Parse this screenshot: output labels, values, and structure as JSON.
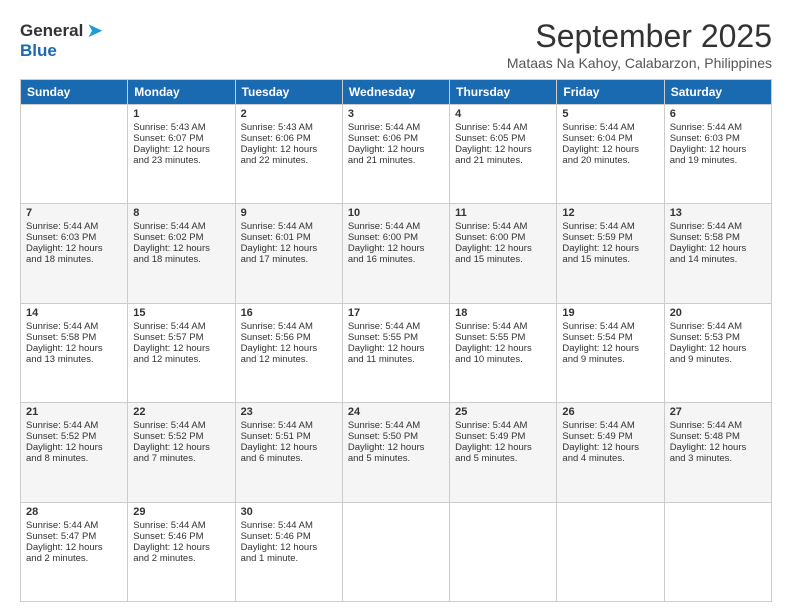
{
  "header": {
    "logo_general": "General",
    "logo_blue": "Blue",
    "title": "September 2025",
    "subtitle": "Mataas Na Kahoy, Calabarzon, Philippines"
  },
  "days_of_week": [
    "Sunday",
    "Monday",
    "Tuesday",
    "Wednesday",
    "Thursday",
    "Friday",
    "Saturday"
  ],
  "weeks": [
    [
      {
        "num": "",
        "lines": []
      },
      {
        "num": "1",
        "lines": [
          "Sunrise: 5:43 AM",
          "Sunset: 6:07 PM",
          "Daylight: 12 hours",
          "and 23 minutes."
        ]
      },
      {
        "num": "2",
        "lines": [
          "Sunrise: 5:43 AM",
          "Sunset: 6:06 PM",
          "Daylight: 12 hours",
          "and 22 minutes."
        ]
      },
      {
        "num": "3",
        "lines": [
          "Sunrise: 5:44 AM",
          "Sunset: 6:06 PM",
          "Daylight: 12 hours",
          "and 21 minutes."
        ]
      },
      {
        "num": "4",
        "lines": [
          "Sunrise: 5:44 AM",
          "Sunset: 6:05 PM",
          "Daylight: 12 hours",
          "and 21 minutes."
        ]
      },
      {
        "num": "5",
        "lines": [
          "Sunrise: 5:44 AM",
          "Sunset: 6:04 PM",
          "Daylight: 12 hours",
          "and 20 minutes."
        ]
      },
      {
        "num": "6",
        "lines": [
          "Sunrise: 5:44 AM",
          "Sunset: 6:03 PM",
          "Daylight: 12 hours",
          "and 19 minutes."
        ]
      }
    ],
    [
      {
        "num": "7",
        "lines": [
          "Sunrise: 5:44 AM",
          "Sunset: 6:03 PM",
          "Daylight: 12 hours",
          "and 18 minutes."
        ]
      },
      {
        "num": "8",
        "lines": [
          "Sunrise: 5:44 AM",
          "Sunset: 6:02 PM",
          "Daylight: 12 hours",
          "and 18 minutes."
        ]
      },
      {
        "num": "9",
        "lines": [
          "Sunrise: 5:44 AM",
          "Sunset: 6:01 PM",
          "Daylight: 12 hours",
          "and 17 minutes."
        ]
      },
      {
        "num": "10",
        "lines": [
          "Sunrise: 5:44 AM",
          "Sunset: 6:00 PM",
          "Daylight: 12 hours",
          "and 16 minutes."
        ]
      },
      {
        "num": "11",
        "lines": [
          "Sunrise: 5:44 AM",
          "Sunset: 6:00 PM",
          "Daylight: 12 hours",
          "and 15 minutes."
        ]
      },
      {
        "num": "12",
        "lines": [
          "Sunrise: 5:44 AM",
          "Sunset: 5:59 PM",
          "Daylight: 12 hours",
          "and 15 minutes."
        ]
      },
      {
        "num": "13",
        "lines": [
          "Sunrise: 5:44 AM",
          "Sunset: 5:58 PM",
          "Daylight: 12 hours",
          "and 14 minutes."
        ]
      }
    ],
    [
      {
        "num": "14",
        "lines": [
          "Sunrise: 5:44 AM",
          "Sunset: 5:58 PM",
          "Daylight: 12 hours",
          "and 13 minutes."
        ]
      },
      {
        "num": "15",
        "lines": [
          "Sunrise: 5:44 AM",
          "Sunset: 5:57 PM",
          "Daylight: 12 hours",
          "and 12 minutes."
        ]
      },
      {
        "num": "16",
        "lines": [
          "Sunrise: 5:44 AM",
          "Sunset: 5:56 PM",
          "Daylight: 12 hours",
          "and 12 minutes."
        ]
      },
      {
        "num": "17",
        "lines": [
          "Sunrise: 5:44 AM",
          "Sunset: 5:55 PM",
          "Daylight: 12 hours",
          "and 11 minutes."
        ]
      },
      {
        "num": "18",
        "lines": [
          "Sunrise: 5:44 AM",
          "Sunset: 5:55 PM",
          "Daylight: 12 hours",
          "and 10 minutes."
        ]
      },
      {
        "num": "19",
        "lines": [
          "Sunrise: 5:44 AM",
          "Sunset: 5:54 PM",
          "Daylight: 12 hours",
          "and 9 minutes."
        ]
      },
      {
        "num": "20",
        "lines": [
          "Sunrise: 5:44 AM",
          "Sunset: 5:53 PM",
          "Daylight: 12 hours",
          "and 9 minutes."
        ]
      }
    ],
    [
      {
        "num": "21",
        "lines": [
          "Sunrise: 5:44 AM",
          "Sunset: 5:52 PM",
          "Daylight: 12 hours",
          "and 8 minutes."
        ]
      },
      {
        "num": "22",
        "lines": [
          "Sunrise: 5:44 AM",
          "Sunset: 5:52 PM",
          "Daylight: 12 hours",
          "and 7 minutes."
        ]
      },
      {
        "num": "23",
        "lines": [
          "Sunrise: 5:44 AM",
          "Sunset: 5:51 PM",
          "Daylight: 12 hours",
          "and 6 minutes."
        ]
      },
      {
        "num": "24",
        "lines": [
          "Sunrise: 5:44 AM",
          "Sunset: 5:50 PM",
          "Daylight: 12 hours",
          "and 5 minutes."
        ]
      },
      {
        "num": "25",
        "lines": [
          "Sunrise: 5:44 AM",
          "Sunset: 5:49 PM",
          "Daylight: 12 hours",
          "and 5 minutes."
        ]
      },
      {
        "num": "26",
        "lines": [
          "Sunrise: 5:44 AM",
          "Sunset: 5:49 PM",
          "Daylight: 12 hours",
          "and 4 minutes."
        ]
      },
      {
        "num": "27",
        "lines": [
          "Sunrise: 5:44 AM",
          "Sunset: 5:48 PM",
          "Daylight: 12 hours",
          "and 3 minutes."
        ]
      }
    ],
    [
      {
        "num": "28",
        "lines": [
          "Sunrise: 5:44 AM",
          "Sunset: 5:47 PM",
          "Daylight: 12 hours",
          "and 2 minutes."
        ]
      },
      {
        "num": "29",
        "lines": [
          "Sunrise: 5:44 AM",
          "Sunset: 5:46 PM",
          "Daylight: 12 hours",
          "and 2 minutes."
        ]
      },
      {
        "num": "30",
        "lines": [
          "Sunrise: 5:44 AM",
          "Sunset: 5:46 PM",
          "Daylight: 12 hours",
          "and 1 minute."
        ]
      },
      {
        "num": "",
        "lines": []
      },
      {
        "num": "",
        "lines": []
      },
      {
        "num": "",
        "lines": []
      },
      {
        "num": "",
        "lines": []
      }
    ]
  ]
}
